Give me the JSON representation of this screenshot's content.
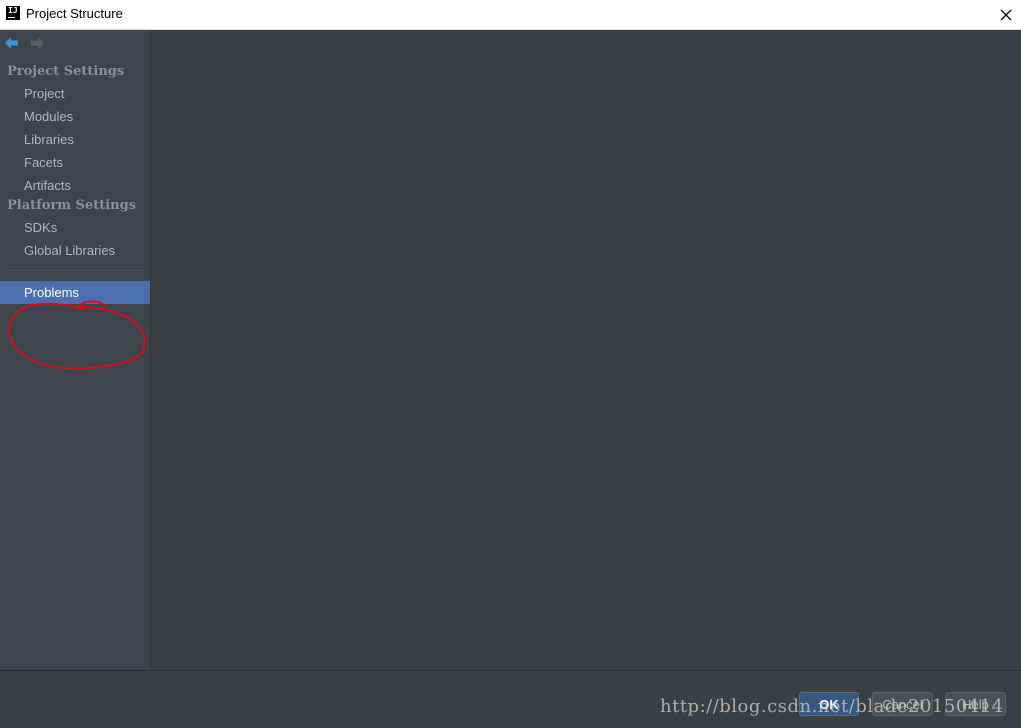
{
  "window": {
    "title": "Project Structure",
    "app_icon_text": "IJ"
  },
  "nav": {
    "back_icon": "arrow-left-icon",
    "forward_icon": "arrow-right-icon"
  },
  "sidebar": {
    "project_settings_header": "Project Settings",
    "project_settings_items": [
      {
        "label": "Project"
      },
      {
        "label": "Modules"
      },
      {
        "label": "Libraries"
      },
      {
        "label": "Facets"
      },
      {
        "label": "Artifacts"
      }
    ],
    "platform_settings_header": "Platform Settings",
    "platform_settings_items": [
      {
        "label": "SDKs"
      },
      {
        "label": "Global Libraries"
      }
    ],
    "problems_label": "Problems",
    "selected": "Problems"
  },
  "buttons": {
    "ok": "OK",
    "cancel": "Cancel",
    "help": "Help"
  },
  "watermark": "http://blog.csdn.net/blade20150414",
  "colors": {
    "selection": "#4b6eaf",
    "sidebar_bg": "#3e434c",
    "content_bg": "#3c3f41",
    "annotation": "#d0101a"
  }
}
